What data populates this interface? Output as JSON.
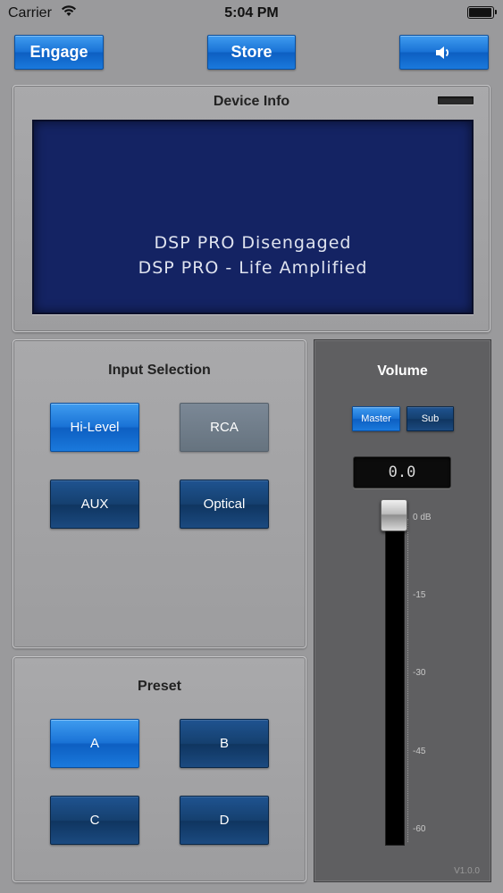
{
  "status_bar": {
    "carrier": "Carrier",
    "time": "5:04 PM",
    "battery_level": 1.0
  },
  "toolbar": {
    "engage_label": "Engage",
    "store_label": "Store",
    "speaker_icon": "speaker-icon"
  },
  "device_info": {
    "title": "Device Info",
    "lcd_line_1": "DSP PRO Disengaged",
    "lcd_line_2": "DSP PRO - Life Amplified"
  },
  "input_selection": {
    "title": "Input Selection",
    "options": [
      "Hi-Level",
      "RCA",
      "AUX",
      "Optical"
    ],
    "selected": "Hi-Level"
  },
  "preset": {
    "title": "Preset",
    "options": [
      "A",
      "B",
      "C",
      "D"
    ],
    "selected": "A"
  },
  "volume": {
    "title": "Volume",
    "master_label": "Master",
    "sub_label": "Sub",
    "selected_channel": "Master",
    "display_value": "0.0",
    "level_db": 0,
    "scale_labels": [
      "0 dB",
      "-15",
      "-30",
      "-45",
      "-60"
    ],
    "version": "V1.0.0"
  },
  "colors": {
    "accent_blue": "#1a73d6",
    "dark_blue": "#15406f",
    "lcd_blue": "#142363",
    "background": "#9a9a9c"
  }
}
